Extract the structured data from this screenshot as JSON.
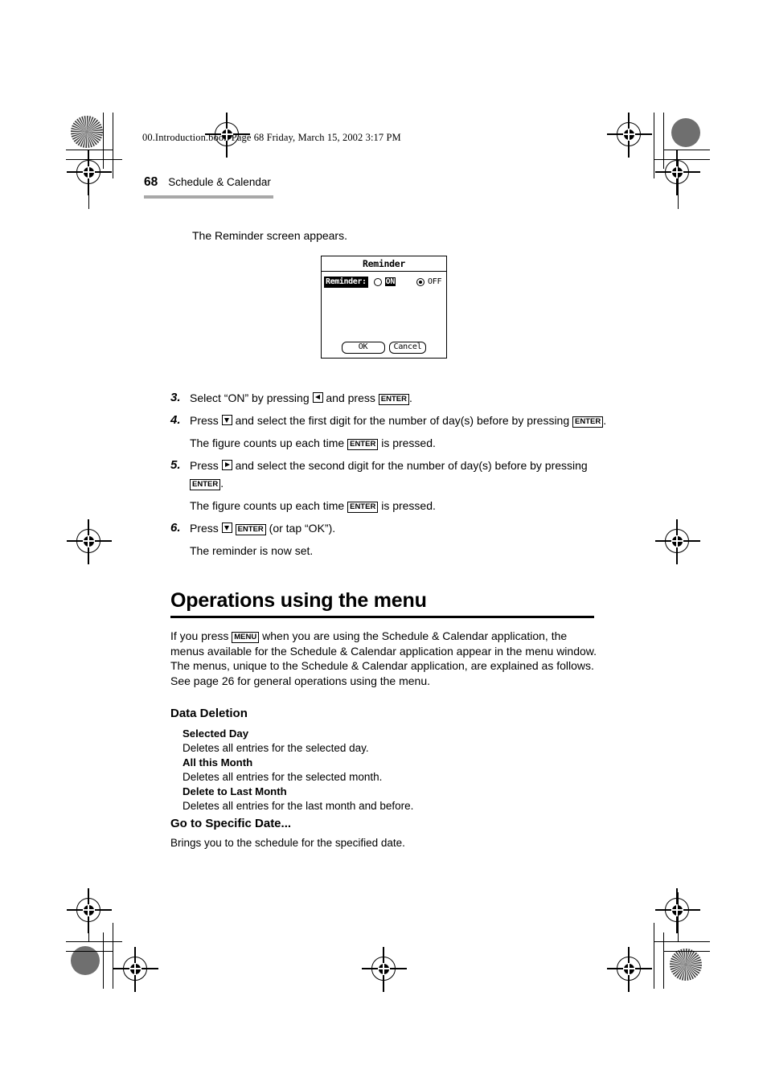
{
  "page": {
    "filename_line": "00.Introduction.book  Page 68  Friday, March 15, 2002  3:17 PM",
    "page_number": "68",
    "section_title": "Schedule & Calendar"
  },
  "intro": {
    "line": "The Reminder screen appears."
  },
  "device_screen": {
    "title": "Reminder",
    "field_label": "Reminder:",
    "option_on": "ON",
    "option_off": "OFF",
    "selected_option": "OFF",
    "ok_label": "OK",
    "cancel_label": "Cancel"
  },
  "steps": [
    {
      "number": "3.",
      "parts": [
        {
          "type": "text",
          "value": "Select “ON” by pressing "
        },
        {
          "type": "key-arrow",
          "value": "left-arrow-key"
        },
        {
          "type": "text",
          "value": " and press "
        },
        {
          "type": "key",
          "value": "ENTER"
        },
        {
          "type": "text",
          "value": "."
        }
      ],
      "note": null
    },
    {
      "number": "4.",
      "parts": [
        {
          "type": "text",
          "value": "Press "
        },
        {
          "type": "key-arrow",
          "value": "down-arrow-key"
        },
        {
          "type": "text",
          "value": " and select the first digit for the number of day(s) before by pressing "
        },
        {
          "type": "key",
          "value": "ENTER"
        },
        {
          "type": "text",
          "value": "."
        }
      ],
      "note_parts": [
        {
          "type": "text",
          "value": "The figure counts up each time "
        },
        {
          "type": "key",
          "value": "ENTER"
        },
        {
          "type": "text",
          "value": " is pressed."
        }
      ]
    },
    {
      "number": "5.",
      "parts": [
        {
          "type": "text",
          "value": "Press "
        },
        {
          "type": "key-arrow",
          "value": "right-arrow-key"
        },
        {
          "type": "text",
          "value": " and select the second digit for the number of day(s) before by pressing "
        },
        {
          "type": "key",
          "value": "ENTER"
        },
        {
          "type": "text",
          "value": "."
        }
      ],
      "note_parts": [
        {
          "type": "text",
          "value": "The figure counts up each time "
        },
        {
          "type": "key",
          "value": "ENTER"
        },
        {
          "type": "text",
          "value": " is pressed."
        }
      ]
    },
    {
      "number": "6.",
      "parts": [
        {
          "type": "text",
          "value": "Press "
        },
        {
          "type": "key-arrow",
          "value": "down-arrow-key"
        },
        {
          "type": "text",
          "value": " "
        },
        {
          "type": "key",
          "value": "ENTER"
        },
        {
          "type": "text",
          "value": " (or tap “OK”)."
        }
      ],
      "note_parts": [
        {
          "type": "text",
          "value": "The reminder is now set."
        }
      ]
    }
  ],
  "section": {
    "heading": "Operations using the menu",
    "paragraph_before_key": "If you press ",
    "paragraph_key": "MENU",
    "paragraph_after_key": " when you are using the Schedule & Calendar application, the menus available for the Schedule & Calendar application appear in the menu window. The menus, unique to the Schedule & Calendar application, are explained as follows. See page 26 for general operations using the menu."
  },
  "data_deletion": {
    "heading": "Data Deletion",
    "items": [
      {
        "title": "Selected Day",
        "desc": "Deletes all entries for the selected day."
      },
      {
        "title": "All this Month",
        "desc": "Deletes all entries for the selected month."
      },
      {
        "title": "Delete to Last Month",
        "desc": "Deletes all entries for the last month and before."
      }
    ]
  },
  "goto_date": {
    "heading": "Go to Specific Date...",
    "desc": "Brings you to the schedule for the specified date."
  }
}
